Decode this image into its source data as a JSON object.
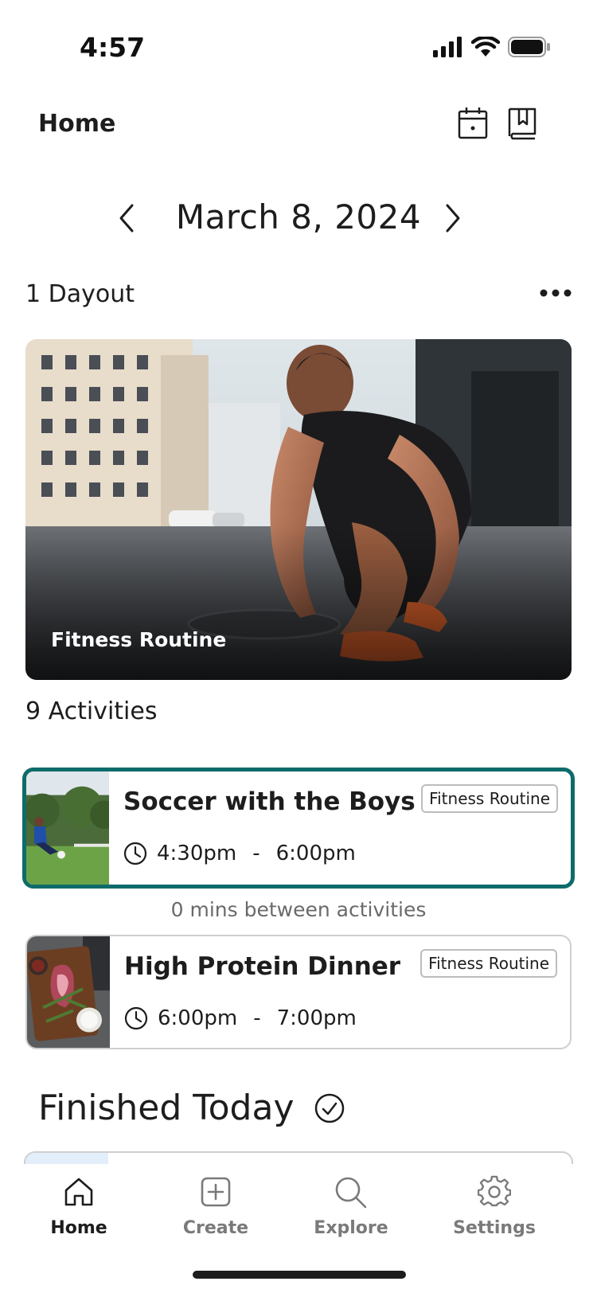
{
  "status_bar": {
    "time": "4:57"
  },
  "header": {
    "title": "Home"
  },
  "date_nav": {
    "date": "March 8, 2024"
  },
  "dayout": {
    "count_label": "1 Dayout",
    "card_title": "Fitness Routine"
  },
  "activities": {
    "count_label": "9 Activities",
    "items": [
      {
        "name": "Soccer with the Boys",
        "tag": "Fitness Routine",
        "start": "4:30pm",
        "separator": "-",
        "end": "6:00pm"
      },
      {
        "name": "High Protein Dinner",
        "tag": "Fitness Routine",
        "start": "6:00pm",
        "separator": "-",
        "end": "7:00pm"
      }
    ],
    "gap_text": "0 mins between activities"
  },
  "finished": {
    "label": "Finished Today"
  },
  "tabs": [
    {
      "label": "Home",
      "icon": "home-icon",
      "active": true
    },
    {
      "label": "Create",
      "icon": "plus-square-icon",
      "active": false
    },
    {
      "label": "Explore",
      "icon": "search-icon",
      "active": false
    },
    {
      "label": "Settings",
      "icon": "gear-icon",
      "active": false
    }
  ],
  "colors": {
    "accent": "#0f6b6b",
    "text": "#1d1d1d",
    "muted": "#7a7a7a",
    "border": "#cfcfcf"
  }
}
